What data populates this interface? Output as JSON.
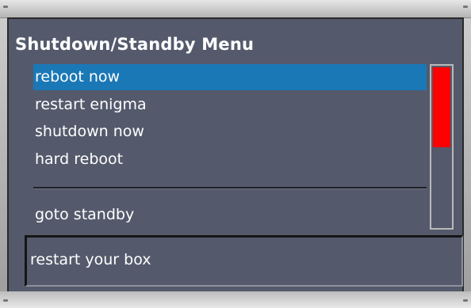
{
  "window": {
    "title": "Shutdown/Standby Menu"
  },
  "menu": {
    "items": [
      {
        "label": "reboot now",
        "selected": true
      },
      {
        "label": "restart enigma",
        "selected": false
      },
      {
        "label": "shutdown now",
        "selected": false
      },
      {
        "label": "hard reboot",
        "selected": false
      },
      {
        "label": "goto standby",
        "selected": false
      }
    ]
  },
  "scrollbar": {
    "thumb_fraction": 0.5,
    "thumb_color": "#ff0000"
  },
  "status": {
    "text": "restart your box"
  },
  "colors": {
    "background": "#545a6c",
    "selection": "#1a78b6",
    "text": "#ffffff"
  }
}
